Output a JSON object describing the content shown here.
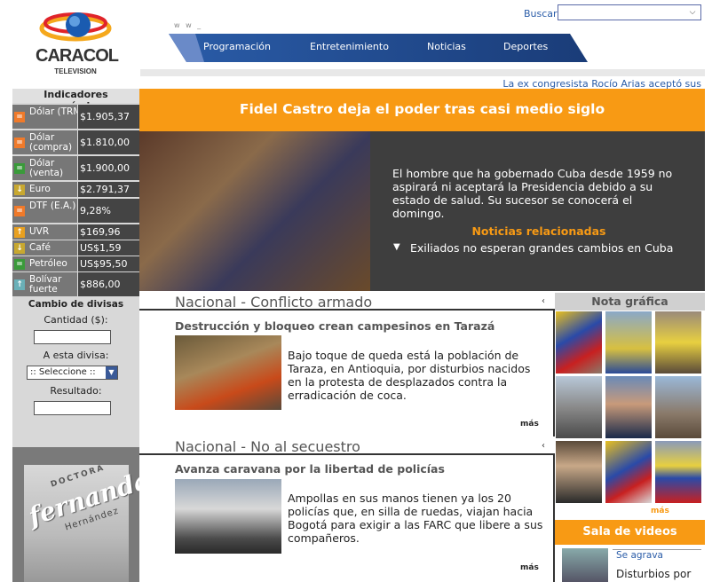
{
  "header": {
    "logo_text": "CARACOL",
    "logo_sub": "TELEVISION",
    "www": "w w _",
    "search_label": "Buscar",
    "nav": [
      "Programación",
      "Entretenimiento",
      "Noticias",
      "Deportes"
    ],
    "ticker": "La ex congresista Rocío Arias aceptó sus"
  },
  "indicators": {
    "title": "Indicadores económicos",
    "rows": [
      {
        "icon": "equal-icon",
        "name": "Dólar (TRM)",
        "value": "$1.905,37"
      },
      {
        "icon": "equal-icon",
        "name": "Dólar (compra)",
        "value": "$1.810,00"
      },
      {
        "icon": "equal-icon",
        "name": "Dólar (venta)",
        "value": "$1.900,00"
      },
      {
        "icon": "arrow-down-icon",
        "name": "Euro",
        "value": "$2.791,37"
      },
      {
        "icon": "equal-icon",
        "name": "DTF (E.A.)",
        "value": "9,28%"
      },
      {
        "icon": "arrow-up-icon",
        "name": "UVR",
        "value": "$169,96"
      },
      {
        "icon": "arrow-down-icon",
        "name": "Café",
        "value": "US$1,59"
      },
      {
        "icon": "equal-icon",
        "name": "Petróleo",
        "value": "US$95,50"
      },
      {
        "icon": "arrow-up-icon",
        "name": "Bolívar fuerte",
        "value": "$886,00"
      }
    ],
    "colors": {
      "equal": "#f07a2a",
      "up": "#e8a020",
      "down": "#c8a830"
    }
  },
  "converter": {
    "title": "Cambio de divisas",
    "amount_label": "Cantidad ($):",
    "target_label": "A esta divisa:",
    "select_value": ":: Seleccione ::",
    "result_label": "Resultado:"
  },
  "ad": {
    "doctora": "DOCTORA",
    "name": "fernanda",
    "surname": "Hernández"
  },
  "feature": {
    "title": "Fidel Castro deja el poder tras casi medio siglo",
    "description": "El hombre que ha gobernado Cuba desde 1959 no aspirará ni aceptará la Presidencia debido a su estado de salud. Su sucesor se conocerá el domingo.",
    "related_title": "Noticias relacionadas",
    "related_item": "Exiliados no esperan grandes cambios en Cuba"
  },
  "sections": [
    {
      "title": "Nacional - Conflicto armado",
      "story_title": "Destrucción y bloqueo crean campesinos en Tarazá",
      "story_text": "Bajo toque de queda está la población de Taraza, en Antioquia, por disturbios nacidos en la protesta de desplazados contra la erradicación de coca.",
      "more": "más"
    },
    {
      "title": "Nacional - No al secuestro",
      "story_title": "Avanza caravana por la libertad de policías",
      "story_text": "Ampollas en sus manos tienen ya los 20 policías que, en silla de ruedas, viajan hacia Bogotá para exigir a las FARC que libere a sus compañeros.",
      "more": "más"
    }
  ],
  "right": {
    "nota_title": "Nota gráfica",
    "nota_more": "más",
    "video_title": "Sala de videos",
    "video_tag": "Se agrava",
    "video_text": "Disturbios por"
  }
}
